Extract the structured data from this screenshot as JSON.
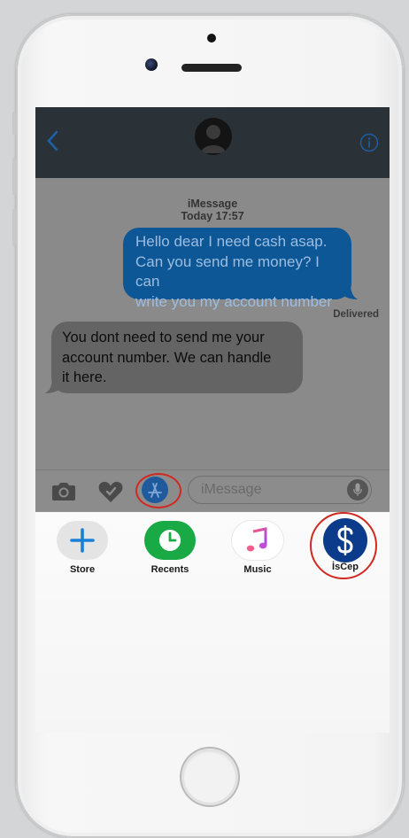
{
  "conversation": {
    "service_label": "iMessage",
    "timestamp": "Today 17:57",
    "messages": [
      {
        "direction": "outgoing",
        "lines": [
          "Hello dear I need cash asap.",
          "Can you send me money? I can",
          "write you my account number"
        ]
      },
      {
        "direction": "incoming",
        "lines": [
          "You dont need to send me your",
          "account number. We can handle",
          "it here."
        ]
      }
    ],
    "status": "Delivered"
  },
  "input_bar": {
    "placeholder": "iMessage",
    "icons": [
      "camera-icon",
      "digital-touch-heart-icon",
      "app-store-icon",
      "microphone-icon"
    ]
  },
  "app_drawer": {
    "apps": [
      {
        "label": "Store",
        "icon": "plus-icon",
        "color": "#1c7fd6"
      },
      {
        "label": "Recents",
        "icon": "clock-icon",
        "color": "#1aaa45"
      },
      {
        "label": "Music",
        "icon": "music-note-icon",
        "color": "#ef4a8a"
      },
      {
        "label": "İsCep",
        "icon": "isbank-logo",
        "color": "#0d3b8c"
      }
    ]
  },
  "colors": {
    "highlight": "#d0291f",
    "outgoing_bubble": "#0e5796",
    "incoming_bubble": "#646464",
    "navbar": "#2a3238"
  }
}
